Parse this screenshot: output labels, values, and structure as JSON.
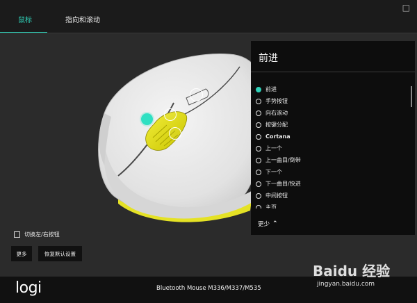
{
  "header": {
    "tabs": [
      {
        "label": "鼠标",
        "active": true
      },
      {
        "label": "指向和滚动",
        "active": false
      }
    ],
    "close_glyph": "□"
  },
  "controls": {
    "swap_buttons_label": "切换左/右按钮",
    "swap_checked": false,
    "more_button": "更多",
    "restore_defaults_button": "恢复默认设置"
  },
  "panel": {
    "title": "前进",
    "options": [
      {
        "label": "前进",
        "selected": true
      },
      {
        "label": "手势按钮",
        "selected": false
      },
      {
        "label": "向右滚动",
        "selected": false
      },
      {
        "label": "按键分配",
        "selected": false
      },
      {
        "label": "Cortana",
        "selected": false,
        "bold": true
      },
      {
        "label": "上一个",
        "selected": false
      },
      {
        "label": "上一曲目/倒带",
        "selected": false
      },
      {
        "label": "下一个",
        "selected": false
      },
      {
        "label": "下一曲目/快进",
        "selected": false
      },
      {
        "label": "中间按钮",
        "selected": false
      },
      {
        "label": "主页",
        "selected": false
      }
    ],
    "less_label": "更少",
    "less_icon": "chevron-up-icon"
  },
  "footer": {
    "logo": "logi",
    "device_name": "Bluetooth Mouse M336/M337/M535"
  },
  "watermark": {
    "text": "Baidu 经验",
    "sub": "jingyan.baidu.com"
  },
  "colors": {
    "accent": "#2fd1b8",
    "mouse_body": "#e9e9e9",
    "wheel_yellow": "#e8e21a",
    "background": "#2b2b2b"
  }
}
